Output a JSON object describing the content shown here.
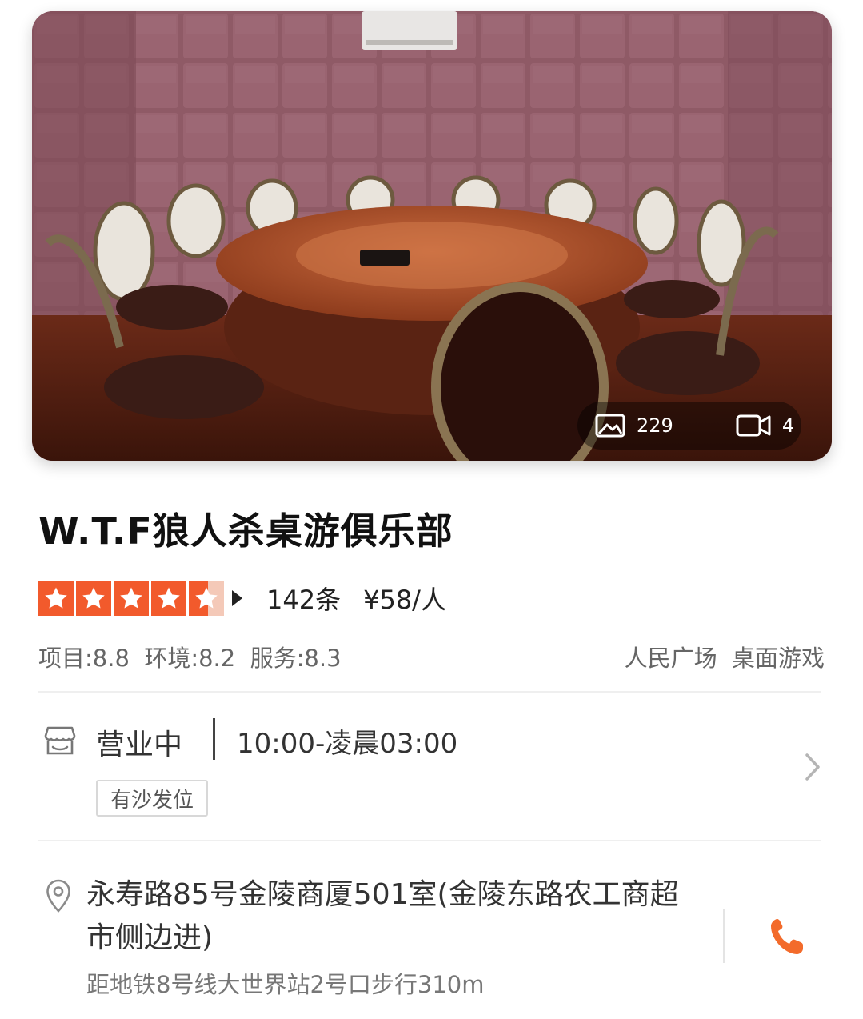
{
  "hero": {
    "image_name": "private-room-photo",
    "photo_count": "229",
    "video_count": "4",
    "photos_icon": "image-icon",
    "videos_icon": "video-camera-icon"
  },
  "shop": {
    "name": "W.T.F狼人杀桌游俱乐部",
    "stars": 4.5,
    "review_count": "142条",
    "avg_price": "¥58/人",
    "scores": "项目:8.8  环境:8.2  服务:8.3",
    "area_category": "人民广场  桌面游戏"
  },
  "hours": {
    "icon": "shop-hours-icon",
    "status": "营业中",
    "time": "10:00-凌晨03:00",
    "tag": "有沙发位"
  },
  "address": {
    "icon": "location-pin-icon",
    "text": "永寿路85号金陵商厦501室(金陵东路农工商超市侧边进)",
    "metro": "距地铁8号线大世界站2号口步行310m",
    "phone_icon": "phone-icon"
  },
  "colors": {
    "accent": "#f25a2c",
    "star_empty": "#f4c9b8",
    "phone": "#f36b2b"
  }
}
